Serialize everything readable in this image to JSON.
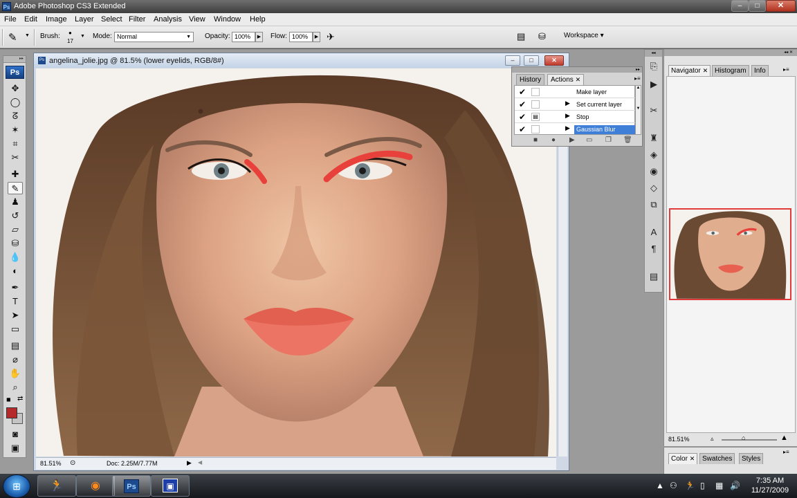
{
  "window": {
    "title": "Adobe Photoshop CS3 Extended",
    "app_icon": "Ps"
  },
  "menu": [
    "File",
    "Edit",
    "Image",
    "Layer",
    "Select",
    "Filter",
    "Analysis",
    "View",
    "Window",
    "Help"
  ],
  "options_bar": {
    "brush_label": "Brush:",
    "brush_size": "17",
    "mode_label": "Mode:",
    "mode_value": "Normal",
    "opacity_label": "Opacity:",
    "opacity_value": "100%",
    "flow_label": "Flow:",
    "flow_value": "100%",
    "workspace_label": "Workspace ▾"
  },
  "toolbox": {
    "logo": "Ps",
    "foreground_color": "#b52a2a",
    "background_color": "#c4c4c4"
  },
  "document": {
    "title": "angelina_jolie.jpg @ 81.5% (lower eyelids, RGB/8#)",
    "zoom": "81.51%",
    "doc_size": "Doc: 2.25M/7.77M"
  },
  "actions_panel": {
    "tabs": [
      "History",
      "Actions"
    ],
    "active_tab": "Actions",
    "rows": [
      {
        "label": "Make layer",
        "checked": true,
        "has_arrow": false,
        "selected": false
      },
      {
        "label": "Set current layer",
        "checked": true,
        "has_arrow": true,
        "selected": false
      },
      {
        "label": "Stop",
        "checked": true,
        "has_arrow": true,
        "selected": false
      },
      {
        "label": "Gaussian Blur",
        "checked": true,
        "has_arrow": true,
        "selected": true
      }
    ]
  },
  "navigator_panel": {
    "tabs": [
      "Navigator",
      "Histogram",
      "Info"
    ],
    "active_tab": "Navigator",
    "zoom": "81.51%"
  },
  "color_panel": {
    "tabs": [
      "Color",
      "Swatches",
      "Styles"
    ],
    "active_tab": "Color"
  },
  "taskbar": {
    "time": "7:35 AM",
    "date": "11/27/2009",
    "apps": [
      "aim-icon",
      "firefox-icon",
      "photoshop-icon",
      "remote-icon"
    ]
  },
  "colors": {
    "accent": "#3f7fd8",
    "makeup_red": "#e8413c",
    "lip": "#e56a58"
  }
}
